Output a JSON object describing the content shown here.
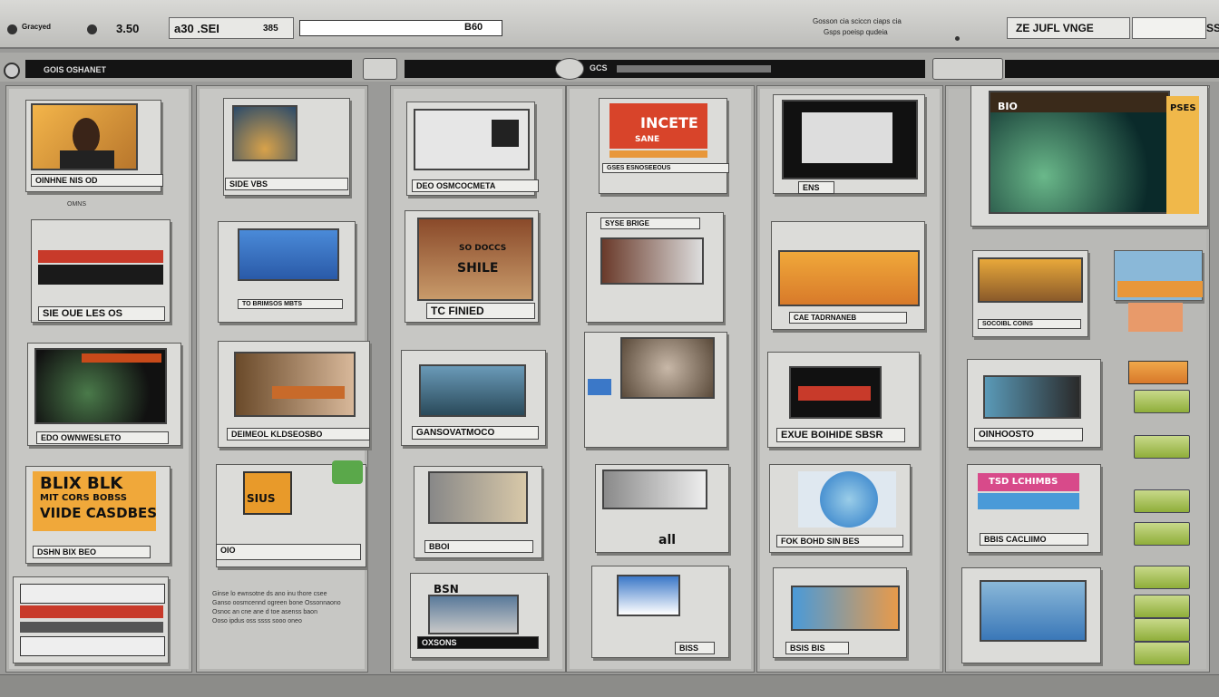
{
  "topbar": {
    "left_label": "Gracyed",
    "count_a": "3.50",
    "count_b": "a30 .SEI",
    "count_b_suffix": "385",
    "field_value": "B60",
    "info_line1": "Gosson cia sciccn ciaps cia",
    "info_line2": "Gsps poeisp qudeia",
    "right_field": "ZE JUFL VNGE",
    "right_badge": "SS"
  },
  "secondbar": {
    "left_label": "GOIS OSHANET",
    "center_label": "GCS"
  },
  "cards": {
    "c1": "OINHNE NIS OD",
    "c2": "SIDE VBS",
    "c3": "DEO OSMCOCMETA",
    "c4_title": "INCETE",
    "c4_sub": "SANE",
    "c4_label": "GSES ESNOSEEOUS",
    "c5": "ENS",
    "c6_top": "BIO",
    "c6_right": "PSES",
    "c7": "SIE OUE LES OS",
    "c8": "TO BRIMSOS MBTS",
    "c9_text": "SO DOCCS",
    "c9_main": "SHILE",
    "c9_label": "TC FINIED",
    "c10_top": "SYSE BRIGE",
    "c11": "CAE TADRNANEB",
    "c12": "SOCOIBL COINS",
    "c13": "EDO OWNWESLETO",
    "c14": "DEIMEOL KLDSEOSBO",
    "c15": "GANSOVATMOCO",
    "c16": "EXUE BOIHIDE SBSR",
    "c17": "OINHOOSTO",
    "c18_top": "BLIX BLK",
    "c18_mid": "MIT CORS BOBSS",
    "c18_bot": "VIIDE CASDBES",
    "c18_label": "DSHN BIX BEO",
    "c19_top": "SIUS",
    "c19_label": "OIO",
    "c20": "BBOI",
    "c21": "all",
    "c22": "FOK BOHD SIN BES",
    "c23_banner": "TSD LCHIMBS",
    "c23_label": "BBIS CACLIIMO",
    "c24_top": "BSN",
    "c24_label": "OXSONS",
    "c25": "BISS",
    "c26": "BSIS BIS",
    "body_text_1": "Ginse lo ewnsotne ds ano inu thore csee",
    "body_text_2": "Ganso oosmcennd ogreen bone Ossonnaono",
    "body_text_3": "Osnoc an cne ane d toe asenss baon",
    "body_text_4": "Ooso ipdus oss ssss sooo oneo"
  },
  "colors": {
    "accent_orange": "#e8973a",
    "accent_red": "#c83a2a",
    "accent_green": "#9ab94a",
    "screen_blue": "#3b78c8"
  }
}
